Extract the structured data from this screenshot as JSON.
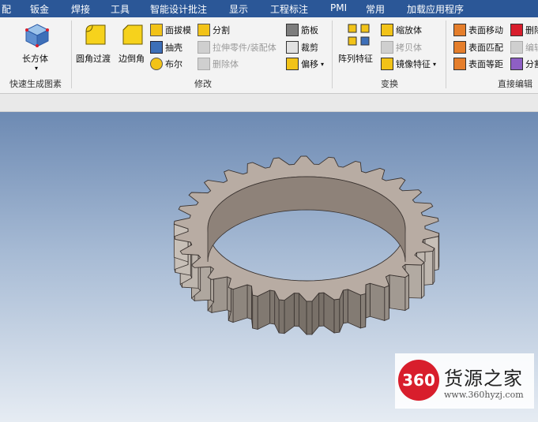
{
  "menu": [
    "配",
    "钣金",
    "焊接",
    "工具",
    "智能设计批注",
    "显示",
    "工程标注",
    "PMI",
    "常用",
    "加载应用程序"
  ],
  "ribbon": {
    "groups": {
      "quick": "快速生成图素",
      "modify": "修改",
      "transform": "变换",
      "direct": "直接编辑"
    },
    "quick": {
      "box": "长方体"
    },
    "modify": {
      "fillet": "圆角过渡",
      "chamfer": "边倒角",
      "draft": "面拔模",
      "shell": "抽壳",
      "boolean": "布尔",
      "split": "分割",
      "stretch_part": "拉伸零件/装配体",
      "delete_body": "删除体",
      "rib": "筋板",
      "trim": "裁剪",
      "offset": "偏移"
    },
    "transform": {
      "array": "阵列特征",
      "scale": "缩放体",
      "copy": "拷贝体",
      "mirror": "镜像特征"
    },
    "direct": {
      "face_move": "表面移动",
      "face_match": "表面匹配",
      "face_equal": "表面等距",
      "del_cut": "删除",
      "edit_cut": "编辑",
      "split_cut": "分割"
    }
  },
  "watermark": {
    "logo": "360",
    "title": "货源之家",
    "url": "www.360hyzj.com"
  },
  "colors": {
    "menubar": "#2b5797",
    "gear_fill": "#b8aca3",
    "gear_inner": "#8e8279",
    "watermark_red": "#d81e2c"
  }
}
